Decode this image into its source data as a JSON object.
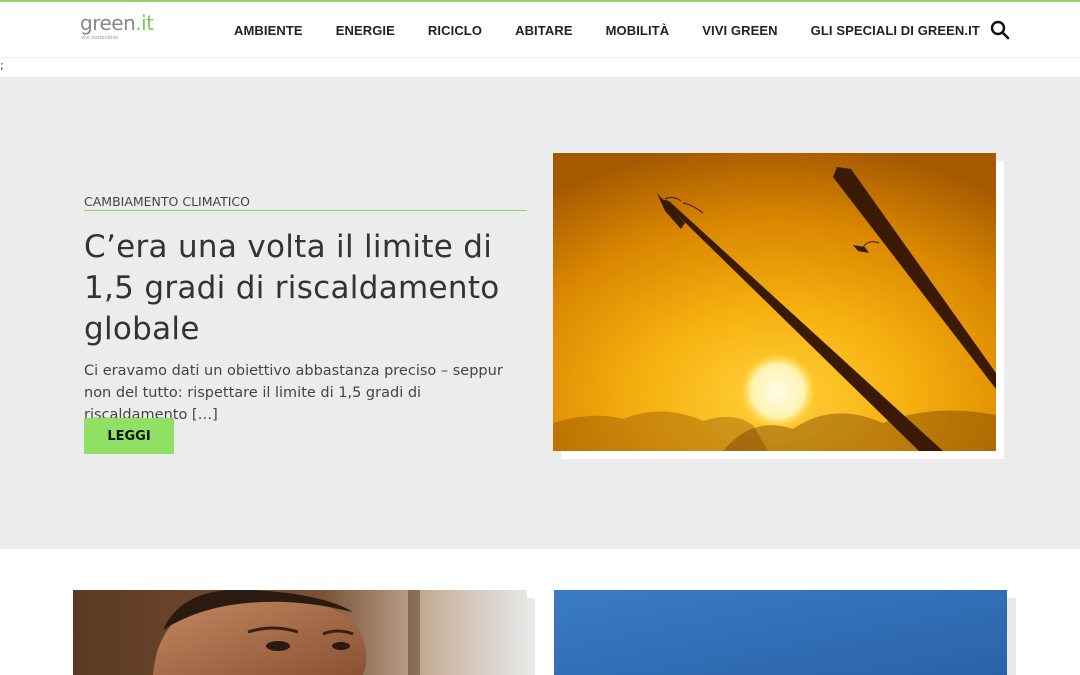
{
  "brand": {
    "logo_main": "green",
    "logo_suffix": ".it",
    "logo_sub": "vivi sostenibile",
    "accent": "#8fd36e",
    "button_color": "#90e065",
    "hero_bg": "#ececec"
  },
  "nav": {
    "items": [
      {
        "label": "AMBIENTE"
      },
      {
        "label": "ENERGIE"
      },
      {
        "label": "RICICLO"
      },
      {
        "label": "ABITARE"
      },
      {
        "label": "MOBILITÀ"
      },
      {
        "label": "VIVI GREEN"
      },
      {
        "label": "GLI SPECIALI DI GREEN.IT"
      }
    ],
    "search_icon": "search-icon"
  },
  "stray_text": ";",
  "hero": {
    "category": "CAMBIAMENTO CLIMATICO",
    "title": "C’era una volta il limite di 1,5 gradi di riscaldamento globale",
    "excerpt": "Ci eravamo dati un obiettivo abbastanza preciso – seppur non del tutto: rispettare il limite di 1,5 gradi di riscaldamento […]",
    "button_label": "LEGGI",
    "image": "sunset-with-branches-photo"
  },
  "cards": [
    {
      "image": "man-portrait-photo"
    },
    {
      "image": "blue-sky-photo"
    }
  ]
}
